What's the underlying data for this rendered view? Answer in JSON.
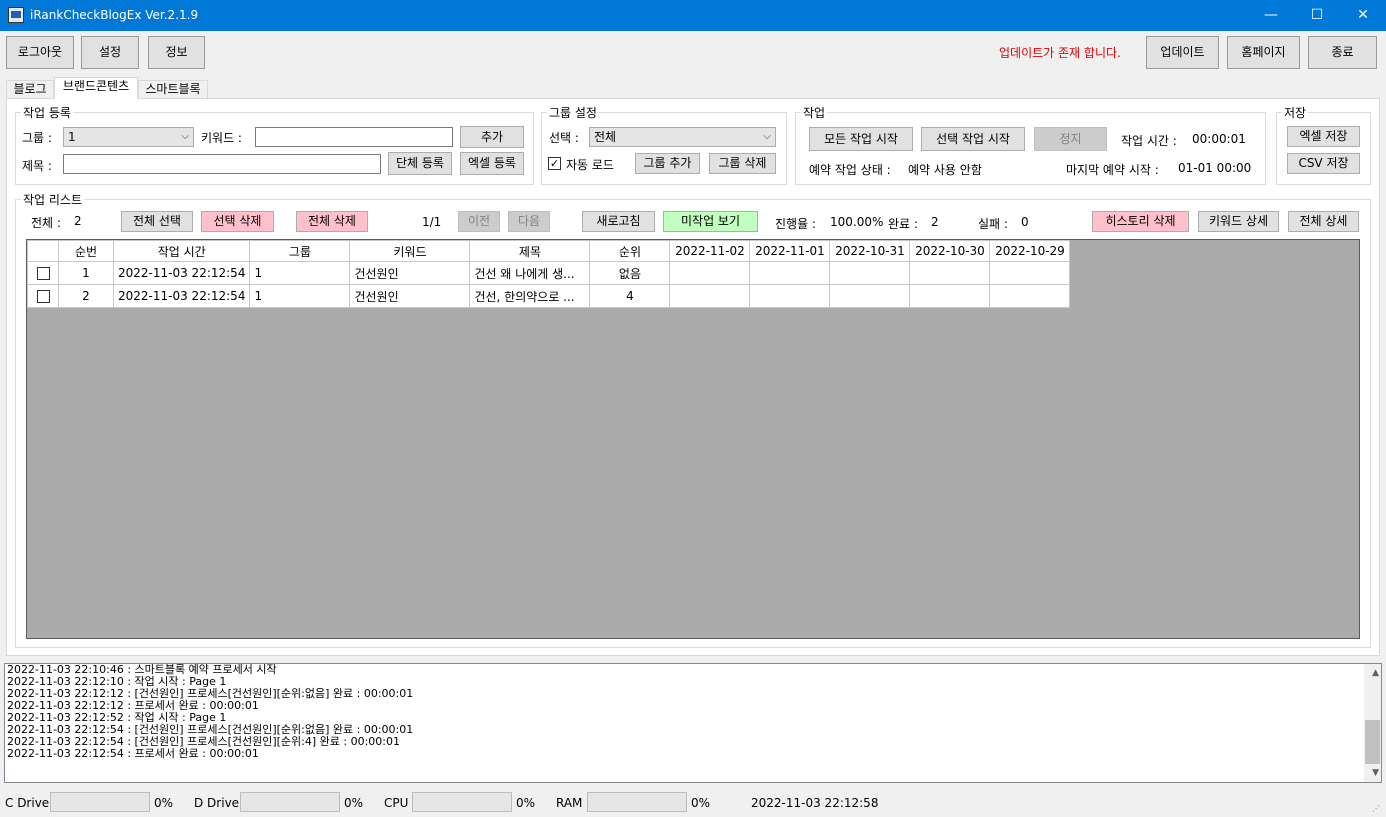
{
  "window": {
    "title": "iRankCheckBlogEx Ver.2.1.9",
    "minimize": "—",
    "maximize": "☐",
    "close": "✕"
  },
  "toolbar": {
    "logout": "로그아웃",
    "settings": "설정",
    "info": "정보",
    "update_notice": "업데이트가 존재 합니다.",
    "update": "업데이트",
    "homepage": "홈페이지",
    "exit": "종료"
  },
  "tabs": [
    "블로그",
    "브랜드콘텐츠",
    "스마트블록"
  ],
  "register": {
    "legend": "작업 등록",
    "group_label": "그룹 :",
    "group_value": "1",
    "keyword_label": "키워드 :",
    "keyword_value": "",
    "title_label": "제목 :",
    "title_value": "",
    "add": "추가",
    "single_register": "단체 등록",
    "excel_register": "엑셀 등록"
  },
  "group_settings": {
    "legend": "그룹 설정",
    "select_label": "선택 :",
    "select_value": "전체",
    "auto_load": "자동 로드",
    "auto_load_checked": true,
    "add_group": "그룹 추가",
    "delete_group": "그룹 삭제"
  },
  "job": {
    "legend": "작업",
    "start_all": "모든 작업 시작",
    "start_selected": "선택 작업 시작",
    "stop": "정지",
    "time_label": "작업 시간 :",
    "time_value": "00:00:01",
    "schedule_label": "예약 작업 상태 :",
    "schedule_value": "예약 사용 안함",
    "last_schedule_label": "마지막 예약 시작 :",
    "last_schedule_value": "01-01 00:00"
  },
  "save": {
    "legend": "저장",
    "excel": "엑셀 저장",
    "csv": "CSV 저장"
  },
  "list": {
    "legend": "작업 리스트",
    "total_label": "전체 :",
    "total_value": "2",
    "select_all": "전체 선택",
    "delete_selected": "선택 삭제",
    "delete_all": "전체 삭제",
    "page": "1/1",
    "prev": "이전",
    "next": "다음",
    "refresh": "새로고침",
    "show_pending": "미작업 보기",
    "progress_label": "진행율 :",
    "progress_value": "100.00%",
    "done_label": "완료 :",
    "done_value": "2",
    "fail_label": "실패 :",
    "fail_value": "0",
    "delete_history": "히스토리 삭제",
    "keyword_detail": "키워드 상세",
    "all_detail": "전체 상세"
  },
  "grid": {
    "columns": [
      "",
      "순번",
      "작업 시간",
      "그룹",
      "키워드",
      "제목",
      "순위",
      "2022-11-02",
      "2022-11-01",
      "2022-10-31",
      "2022-10-30",
      "2022-10-29"
    ],
    "rows": [
      {
        "no": "1",
        "time": "2022-11-03 22:12:54",
        "group": "1",
        "keyword": "건선원인",
        "title": "건선 왜 나에게 생...",
        "rank": "없음",
        "d1": "",
        "d2": "",
        "d3": "",
        "d4": "",
        "d5": ""
      },
      {
        "no": "2",
        "time": "2022-11-03 22:12:54",
        "group": "1",
        "keyword": "건선원인",
        "title": "건선, 한의약으로 ...",
        "rank": "4",
        "d1": "",
        "d2": "",
        "d3": "",
        "d4": "",
        "d5": ""
      }
    ]
  },
  "log": [
    "2022-11-03 22:10:46 : 스마트블록 예약 프로세서 시작",
    "2022-11-03 22:12:10 : 작업 시작 : Page 1",
    "2022-11-03 22:12:12 : [건선원인] 프로세스[건선원인][순위:없음] 완료 : 00:00:01",
    "2022-11-03 22:12:12 : 프로세서 완료 : 00:00:01",
    "2022-11-03 22:12:52 : 작업 시작 : Page 1",
    "2022-11-03 22:12:54 : [건선원인] 프로세스[건선원인][순위:없음] 완료 : 00:00:01",
    "2022-11-03 22:12:54 : [건선원인] 프로세스[건선원인][순위:4] 완료 : 00:00:01",
    "2022-11-03 22:12:54 : 프로세서 완료 : 00:00:01"
  ],
  "status": {
    "c_drive_label": "C Drive",
    "c_drive_value": "0%",
    "d_drive_label": "D Drive",
    "d_drive_value": "0%",
    "cpu_label": "CPU",
    "cpu_value": "0%",
    "ram_label": "RAM",
    "ram_value": "0%",
    "clock": "2022-11-03 22:12:58"
  }
}
